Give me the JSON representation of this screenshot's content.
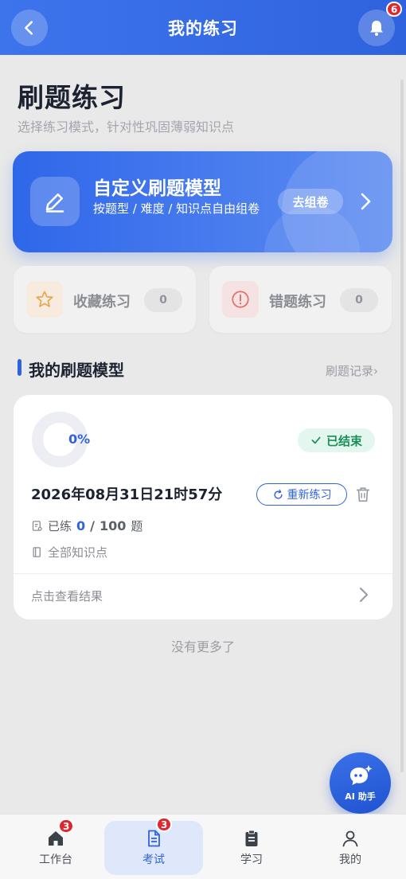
{
  "header": {
    "title": "我的练习",
    "notification_count": "6"
  },
  "intro": {
    "title": "刷题练习",
    "subtitle": "选择练习模式，针对性巩固薄弱知识点"
  },
  "hero": {
    "title": "自定义刷题模型",
    "description": "按题型 / 难度 / 知识点自由组卷",
    "button_label": "去组卷"
  },
  "quick_cards": [
    {
      "label": "收藏练习",
      "count": "0"
    },
    {
      "label": "错题练习",
      "count": "0"
    }
  ],
  "section": {
    "title": "我的刷题模型",
    "link": "刷题记录›"
  },
  "record": {
    "progress_text": "0%",
    "progress_fraction": 0,
    "status": "已结束",
    "date": "2026年08月31日21时57分",
    "redo_label": "重新练习",
    "practiced_label": "已练",
    "practiced_count": "0",
    "separator": "/",
    "total_count": "100",
    "unit": "题",
    "scope": "全部知识点",
    "view_result": "点击查看结果"
  },
  "no_more": "没有更多了",
  "fab": {
    "label": "AI 助手"
  },
  "tabbar": {
    "items": [
      {
        "label": "工作台",
        "badge": "3"
      },
      {
        "label": "考试",
        "badge": "3"
      },
      {
        "label": "学习"
      },
      {
        "label": "我的"
      }
    ],
    "active_index": 1
  },
  "colors": {
    "primary": "#2f63de",
    "success": "#1a8f5a",
    "badge": "#e0262f"
  }
}
